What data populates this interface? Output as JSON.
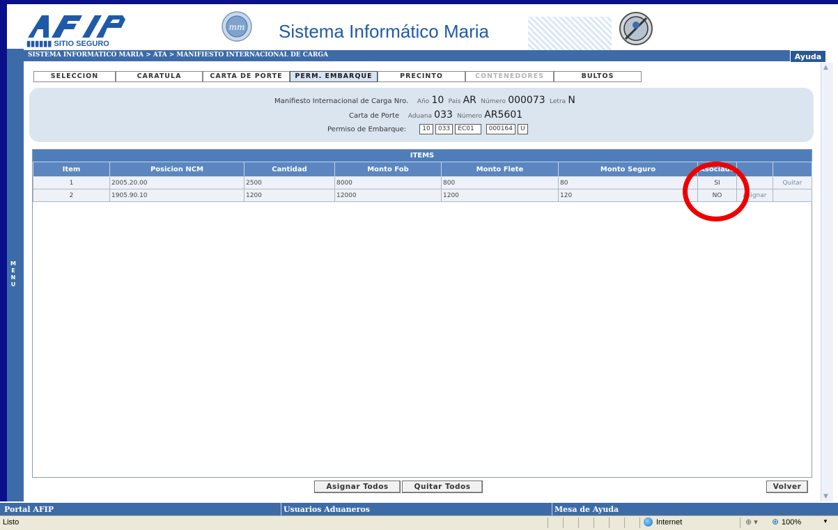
{
  "header": {
    "logo_text": "AFIP",
    "logo_subtitle": "SITIO SEGURO",
    "system_title": "Sistema Informático Maria"
  },
  "breadcrumb": "SISTEMA INFORMATICO MARIA > ATA > MANIFIESTO INTERNACIONAL DE CARGA",
  "help_label": "Ayuda",
  "menu_label": [
    "M",
    "E",
    "N",
    "U"
  ],
  "tabs": [
    {
      "label": "SELECCION",
      "state": "normal"
    },
    {
      "label": "CARATULA",
      "state": "normal"
    },
    {
      "label": "CARTA DE PORTE",
      "state": "normal"
    },
    {
      "label": "PERM. EMBARQUE",
      "state": "active"
    },
    {
      "label": "PRECINTO",
      "state": "normal"
    },
    {
      "label": "CONTENEDORES",
      "state": "disabled"
    },
    {
      "label": "BULTOS",
      "state": "normal"
    }
  ],
  "info": {
    "manifiesto_label": "Manifiesto Internacional de Carga Nro.",
    "anio_label": "Año",
    "anio": "10",
    "pais_label": "Pais",
    "pais": "AR",
    "numero_label": "Número",
    "numero": "000073",
    "letra_label": "Letra",
    "letra": "N",
    "carta_label": "Carta de Porte",
    "aduana_label": "Aduana",
    "aduana": "033",
    "carta_numero_label": "Número",
    "carta_numero": "AR5601",
    "permiso_label": "Permiso de Embarque:",
    "permiso_fields": [
      "10",
      "033",
      "EC01",
      "000164",
      "U"
    ]
  },
  "items": {
    "title": "ITEMS",
    "columns": [
      "Item",
      "Posicion NCM",
      "Cantidad",
      "Monto Fob",
      "Monto Flete",
      "Monto Seguro",
      "Asociado",
      "",
      ""
    ],
    "rows": [
      {
        "item": "1",
        "ncm": "2005.20.00",
        "cantidad": "2500",
        "fob": "8000",
        "flete": "800",
        "seguro": "80",
        "asociado": "SI",
        "action1": "",
        "action2": "Quitar"
      },
      {
        "item": "2",
        "ncm": "1905.90.10",
        "cantidad": "1200",
        "fob": "12000",
        "flete": "1200",
        "seguro": "120",
        "asociado": "NO",
        "action1": "Asignar",
        "action2": ""
      }
    ]
  },
  "buttons": {
    "asignar_todos": "Asignar Todos",
    "quitar_todos": "Quitar Todos",
    "volver": "Volver"
  },
  "footer": {
    "portal": "Portal AFIP",
    "usuarios": "Usuarios Aduaneros",
    "mesa": "Mesa de Ayuda"
  },
  "statusbar": {
    "status": "Listo",
    "zone": "Internet",
    "zoom": "100%"
  },
  "colors": {
    "accent": "#3d6ba8",
    "table_header": "#5b86bf",
    "highlight": "#ee0000"
  }
}
